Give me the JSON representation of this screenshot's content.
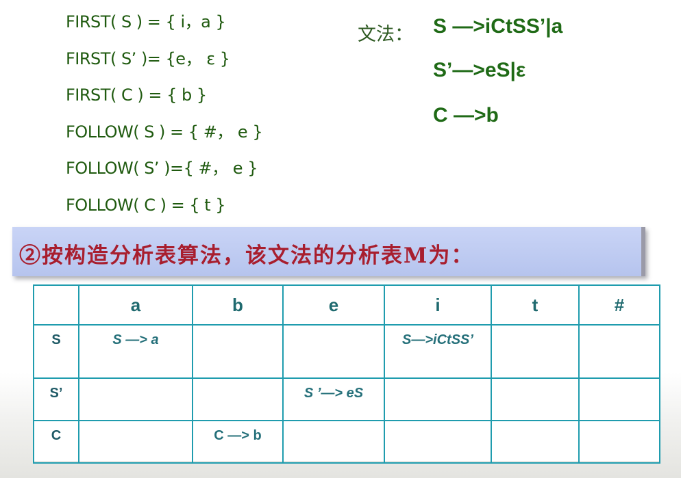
{
  "first_follow": [
    "FIRST( S ) = { i，a }",
    "FIRST( S’ )= {e， ε }",
    "FIRST( C ) = { b }",
    "FOLLOW( S ) = { #， e }",
    "FOLLOW( S’ )={ #， e }",
    "FOLLOW( C ) = { t }"
  ],
  "grammar": {
    "label": "文法：",
    "rules": [
      "S —>iCtSS’|a",
      "S’—>eS|ε",
      "C —>b"
    ]
  },
  "banner": {
    "text": "②按构造分析表算法，该文法的分析表M为："
  },
  "table": {
    "columns": [
      "",
      "a",
      "b",
      "e",
      "i",
      "t",
      "#"
    ],
    "rows": [
      {
        "nonterminal": "S",
        "cells": [
          "S —> a",
          "",
          "",
          "S—>iCtSS’",
          "",
          ""
        ]
      },
      {
        "nonterminal": "S’",
        "cells": [
          "",
          "",
          "S ’—> eS",
          "",
          "",
          ""
        ]
      },
      {
        "nonterminal": "C",
        "cells": [
          "",
          "C —> b",
          "",
          "",
          "",
          ""
        ]
      }
    ]
  },
  "colors": {
    "set_text": "#1f5a0f",
    "rule_text": "#1f6a16",
    "banner_bg": "#c0ccf2",
    "banner_text": "#a81e2e",
    "table_border": "#1f9cae",
    "table_text": "#25707a"
  }
}
